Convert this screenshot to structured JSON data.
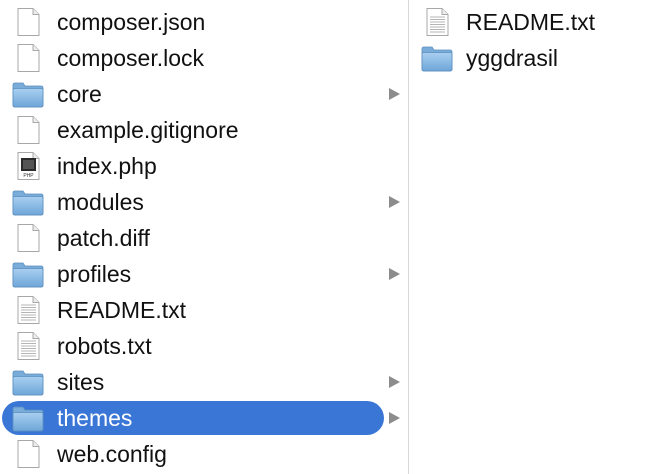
{
  "left_column": {
    "items": [
      {
        "name": "composer.json",
        "type": "file",
        "icon": "document-icon",
        "has_children": false,
        "selected": false
      },
      {
        "name": "composer.lock",
        "type": "file",
        "icon": "document-icon",
        "has_children": false,
        "selected": false
      },
      {
        "name": "core",
        "type": "folder",
        "icon": "folder-icon",
        "has_children": true,
        "selected": false
      },
      {
        "name": "example.gitignore",
        "type": "file",
        "icon": "document-icon",
        "has_children": false,
        "selected": false
      },
      {
        "name": "index.php",
        "type": "php",
        "icon": "php-file-icon",
        "icon_text": "PHP",
        "has_children": false,
        "selected": false
      },
      {
        "name": "modules",
        "type": "folder",
        "icon": "folder-icon",
        "has_children": true,
        "selected": false
      },
      {
        "name": "patch.diff",
        "type": "file",
        "icon": "document-icon",
        "has_children": false,
        "selected": false
      },
      {
        "name": "profiles",
        "type": "folder",
        "icon": "folder-icon",
        "has_children": true,
        "selected": false
      },
      {
        "name": "README.txt",
        "type": "text",
        "icon": "text-document-icon",
        "has_children": false,
        "selected": false
      },
      {
        "name": "robots.txt",
        "type": "text",
        "icon": "text-document-icon",
        "has_children": false,
        "selected": false
      },
      {
        "name": "sites",
        "type": "folder",
        "icon": "folder-icon",
        "has_children": true,
        "selected": false
      },
      {
        "name": "themes",
        "type": "folder",
        "icon": "folder-icon",
        "has_children": true,
        "selected": true
      },
      {
        "name": "web.config",
        "type": "file",
        "icon": "document-icon",
        "has_children": false,
        "selected": false
      }
    ]
  },
  "right_column": {
    "items": [
      {
        "name": "README.txt",
        "type": "text",
        "icon": "text-document-icon",
        "has_children": false,
        "selected": false
      },
      {
        "name": "yggdrasil",
        "type": "folder",
        "icon": "folder-icon",
        "has_children": false,
        "selected": false
      }
    ]
  },
  "colors": {
    "selection": "#3a76d6",
    "folder": "#8fbde6",
    "arrow": "#8c8c8c"
  }
}
